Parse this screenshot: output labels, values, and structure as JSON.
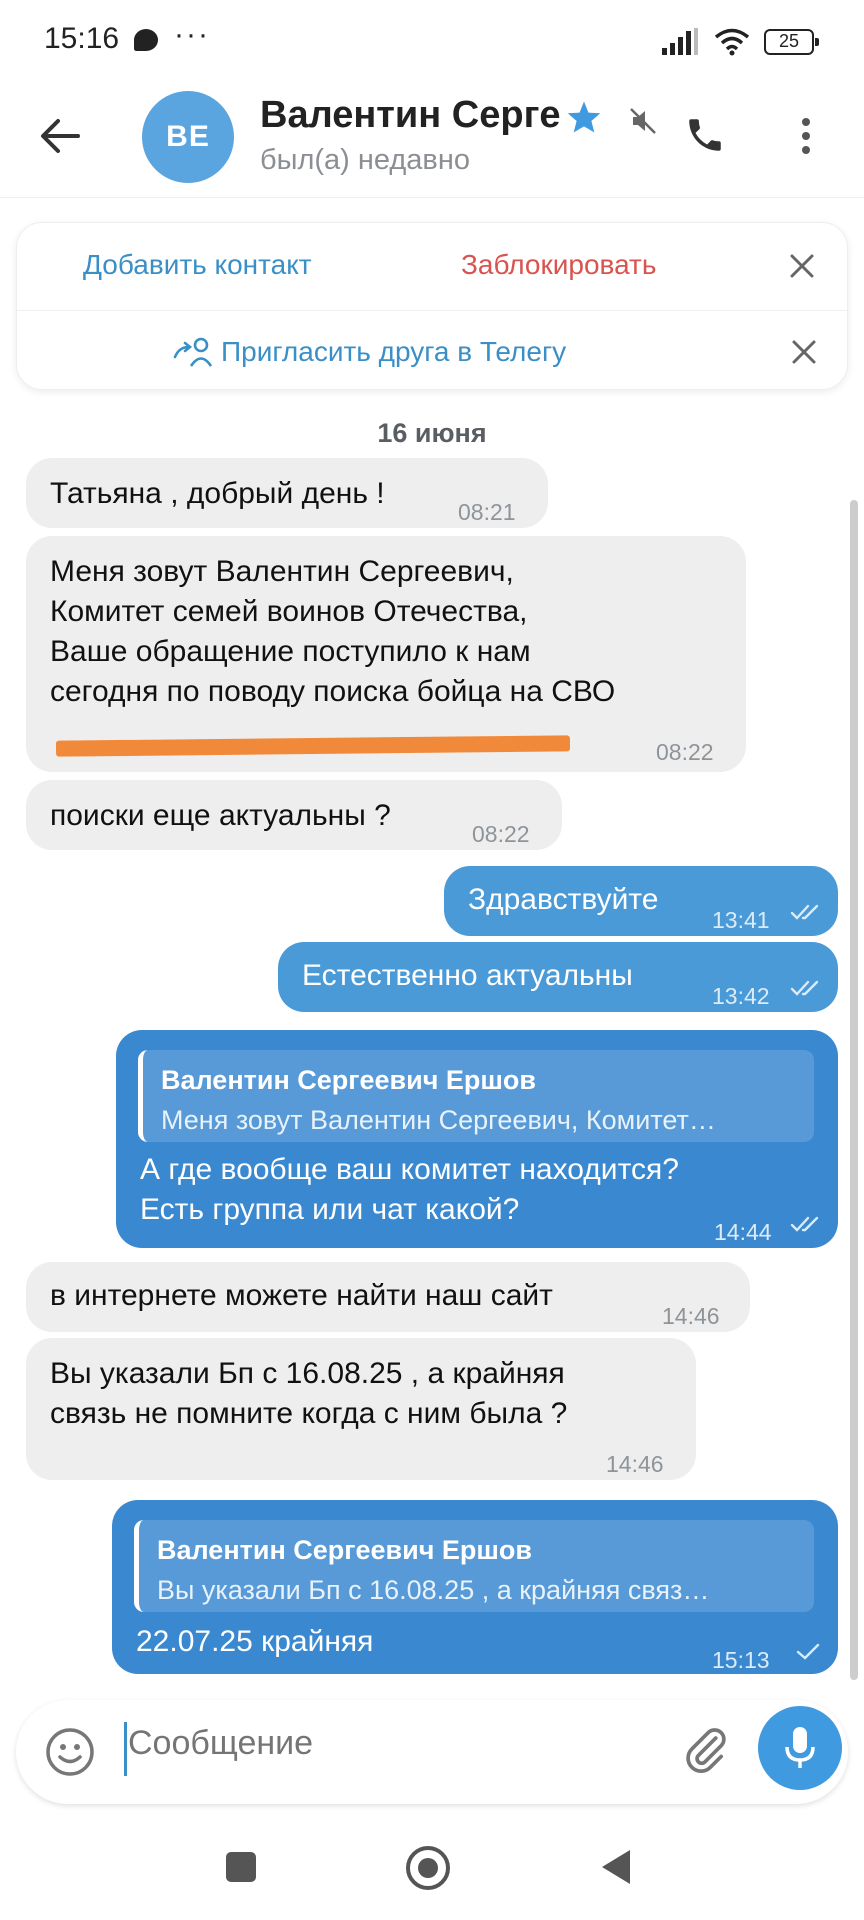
{
  "status_bar": {
    "time": "15:16",
    "dots": "···",
    "battery": "25"
  },
  "header": {
    "avatar_initials": "ВЕ",
    "name": "Валентин Серге",
    "status": "был(а) недавно"
  },
  "action_panel": {
    "add_contact": "Добавить контакт",
    "block": "Заблокировать",
    "invite": "Пригласить друга в Телегу"
  },
  "date_separator": "16 июня",
  "messages": [
    {
      "dir": "in",
      "text": "Татьяна , добрый день !",
      "time": "08:21"
    },
    {
      "dir": "in",
      "lines": [
        "Меня зовут Валентин Сергеевич,",
        "Комитет семей воинов Отечества,",
        "Ваше обращение поступило к нам",
        "сегодня по поводу поиска бойца на СВО"
      ],
      "time": "08:22"
    },
    {
      "dir": "in",
      "text": "поиски еще актуальны ?",
      "time": "08:22"
    },
    {
      "dir": "out",
      "text": "Здравствуйте",
      "time": "13:41"
    },
    {
      "dir": "out",
      "text": "Естественно актуальны",
      "time": "13:42"
    },
    {
      "dir": "out",
      "reply_author": "Валентин Сергеевич Ершов",
      "reply_text": "Меня зовут Валентин Сергеевич, Комитет…",
      "lines": [
        "А где вообще ваш комитет находится?",
        "Есть группа или чат какой?"
      ],
      "time": "14:44"
    },
    {
      "dir": "in",
      "text": "в интернете можете найти наш сайт",
      "time": "14:46"
    },
    {
      "dir": "in",
      "lines": [
        "Вы указали  Бп с 16.08.25 , а крайняя",
        "связь не помните когда с ним была ?"
      ],
      "time": "14:46"
    },
    {
      "dir": "out",
      "reply_author": "Валентин Сергеевич Ершов",
      "reply_text": "Вы указали  Бп с 16.08.25 , а крайняя связ…",
      "text": "22.07.25 крайняя",
      "time": "15:13"
    }
  ],
  "composer": {
    "placeholder": "Сообщение"
  },
  "colors": {
    "accent": "#4a9ad8",
    "incoming": "#eeeeef",
    "danger": "#d9534f",
    "redaction": "#f08a3a"
  }
}
